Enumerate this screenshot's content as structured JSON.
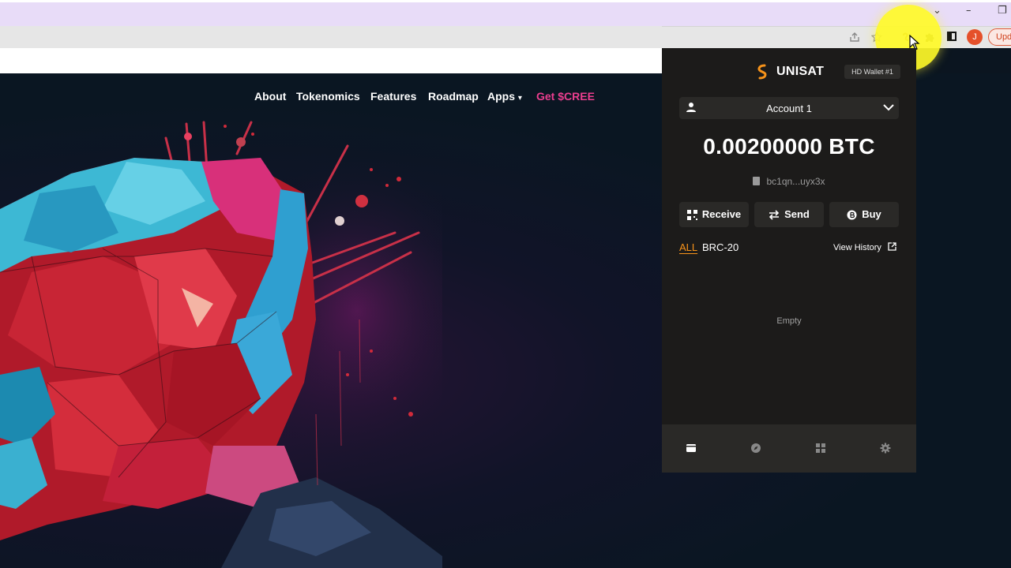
{
  "browser": {
    "window_controls": {
      "chevron": "⌄",
      "minimize": "–",
      "restore": "❐"
    },
    "toolbar_icons": [
      "share-icon",
      "star-icon",
      "unisat-extension-icon",
      "puzzle-icon",
      "sidepanel-icon"
    ],
    "avatar_letter": "J",
    "update_label": "Upd"
  },
  "site": {
    "nav": {
      "about": "About",
      "tokenomics": "Tokenomics",
      "features": "Features",
      "roadmap": "Roadmap",
      "apps": "Apps",
      "apps_caret": "▾",
      "get_cree": "Get $CREE"
    },
    "accent_color": "#ec3e8f"
  },
  "wallet": {
    "title": "UNISAT",
    "badge": "HD Wallet #1",
    "account": "Account 1",
    "balance": "0.00200000 BTC",
    "address": "bc1qn...uyx3x",
    "buttons": {
      "receive": "Receive",
      "send": "Send",
      "buy": "Buy"
    },
    "tabs": {
      "all": "ALL",
      "brc20": "BRC-20"
    },
    "view_history": "View History",
    "empty": "Empty",
    "footer_icons": [
      "wallet-icon",
      "compass-icon",
      "apps-grid-icon",
      "settings-gear-icon"
    ],
    "brand_color": "#f7931a"
  }
}
